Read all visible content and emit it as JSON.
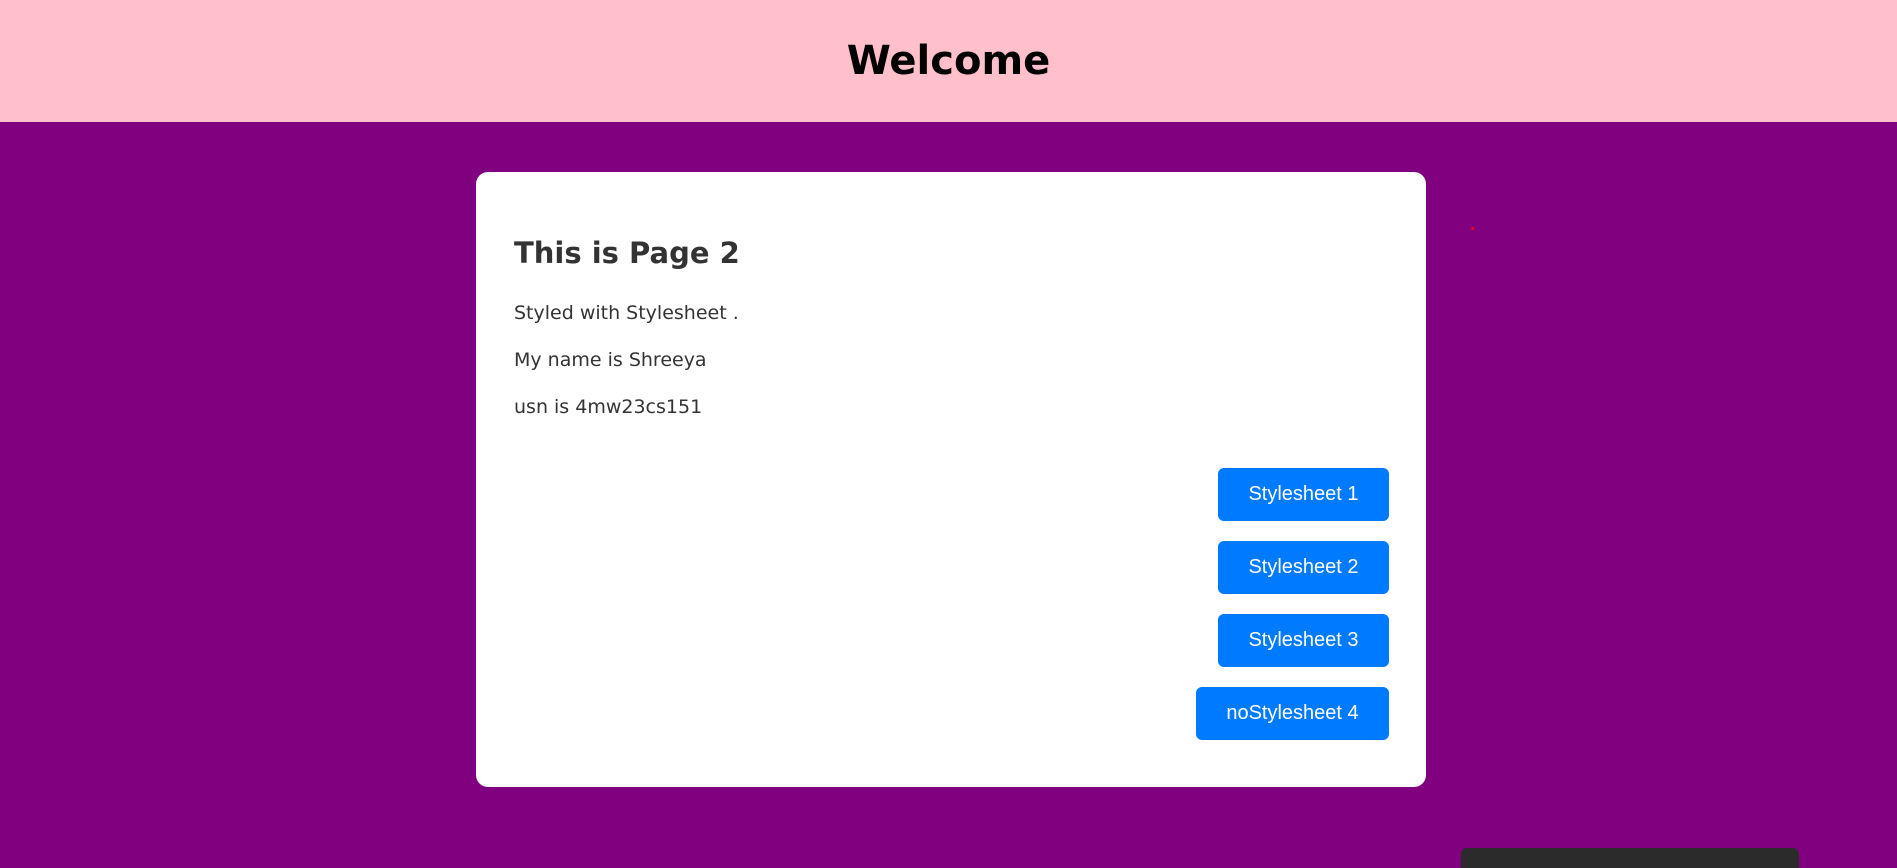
{
  "header": {
    "title": "Welcome"
  },
  "card": {
    "heading": "This is Page 2",
    "lines": [
      "Styled with Stylesheet .",
      "My name is Shreeya",
      "usn is 4mw23cs151"
    ],
    "buttons": [
      "Stylesheet 1",
      "Stylesheet 2",
      "Stylesheet 3",
      "noStylesheet 4"
    ]
  },
  "colors": {
    "page_background": "#800080",
    "header_background": "#ffc0cb",
    "button_background": "#007bff"
  }
}
